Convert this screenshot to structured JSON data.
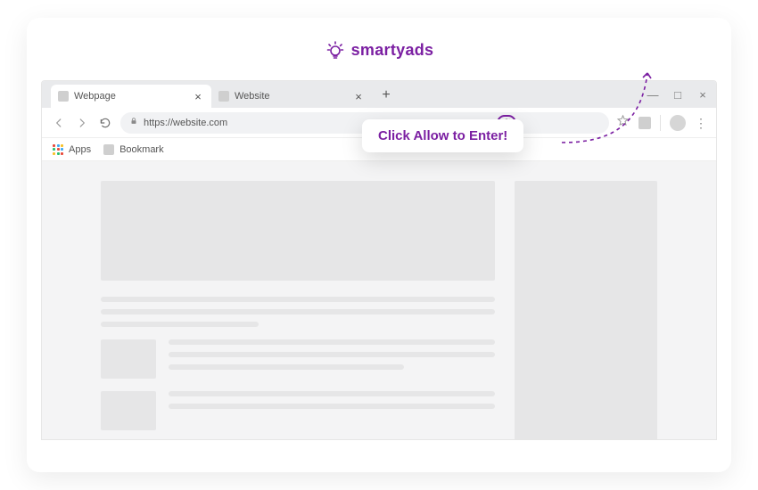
{
  "brand": {
    "name": "smartyads",
    "color": "#7b1fa2"
  },
  "tabs": [
    {
      "title": "Webpage",
      "active": true
    },
    {
      "title": "Website",
      "active": false
    }
  ],
  "address": {
    "url": "https://website.com"
  },
  "bookmarks": {
    "apps_label": "Apps",
    "items": [
      {
        "label": "Bookmark"
      }
    ]
  },
  "callout": {
    "text": "Click Allow to Enter!"
  }
}
